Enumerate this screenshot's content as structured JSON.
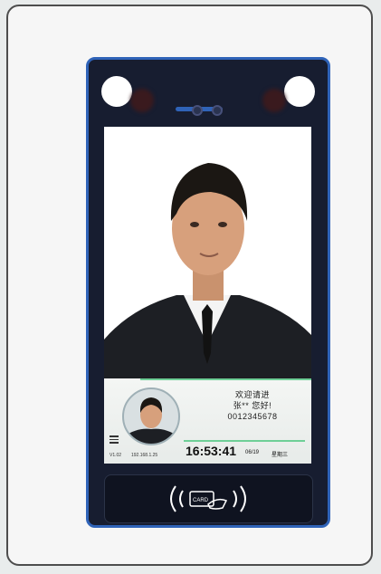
{
  "screen": {
    "welcome": "欢迎请进",
    "greeting": "张** 您好!",
    "id_number": "0012345678"
  },
  "status_bar": {
    "version": "V1.02",
    "ip": "192.168.1.25",
    "time": "16:53:41",
    "date": "06/19",
    "weekday": "星期三"
  },
  "reader": {
    "card_label": "CARD"
  },
  "colors": {
    "frame": "#2f63b8",
    "accent_line": "#6fcf97",
    "device_body": "#171d30"
  },
  "icons": [
    "menu-icon",
    "card-reader-icon",
    "contactless-wave-icon"
  ]
}
